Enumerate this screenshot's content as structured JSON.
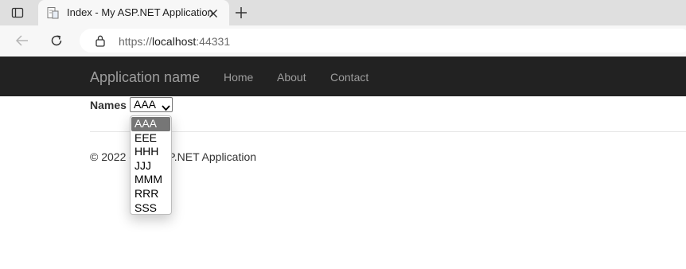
{
  "browser": {
    "tab_title": "Index - My ASP.NET Application",
    "url_scheme": "https://",
    "url_host": "localhost",
    "url_port": ":44331"
  },
  "navbar": {
    "brand": "Application name",
    "links": [
      "Home",
      "About",
      "Contact"
    ]
  },
  "form": {
    "label": "Names",
    "selected_value": "AAA",
    "options": [
      "AAA",
      "EEE",
      "HHH",
      "JJJ",
      "MMM",
      "RRR",
      "SSS"
    ]
  },
  "footer": {
    "text": "© 2022 - My ASP.NET Application"
  },
  "colors": {
    "navbar_bg": "#222222",
    "nav_text": "#9d9d9d",
    "selected_option_bg": "#767676"
  }
}
